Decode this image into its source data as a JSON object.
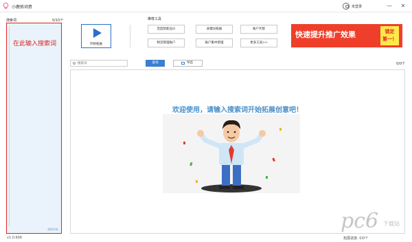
{
  "window": {
    "title": "小鹿拓词意",
    "login_label": "未登录",
    "minimize": "—",
    "close": "✕"
  },
  "left_panel": {
    "header": "搜索词",
    "count": "0/10个",
    "hint": "在此输入搜索词",
    "footer_link": "清除所有",
    "version": "v1.0.606"
  },
  "start": {
    "label": "开始拓展"
  },
  "tools": {
    "title": "推荐工具",
    "items": [
      "百度智能竞价",
      "关键词拓展",
      "账户代管",
      "物流管理账户",
      "账户集中管理",
      "更多工具>>"
    ]
  },
  "banner": {
    "main": "快速提升推广效果",
    "badge_line1": "锁定",
    "badge_line2": "第一！",
    "colors": {
      "background": "#ef3f2a",
      "badge": "#ffe94a"
    }
  },
  "search": {
    "placeholder": "搜索词",
    "query_label": "查询",
    "export_label": "导出",
    "result_count": "0/0个"
  },
  "result": {
    "welcome": "欢迎使用，请输入搜索词开始拓展创意吧！"
  },
  "status": {
    "text": "拓展进度:    0/0个"
  },
  "watermark": {
    "text": "pc6",
    "subtext": "下载站"
  },
  "colors": {
    "accent": "#2a6fc7",
    "list_border": "#e02020",
    "list_bg": "#eaf3fb",
    "welcome": "#4a90c8"
  }
}
